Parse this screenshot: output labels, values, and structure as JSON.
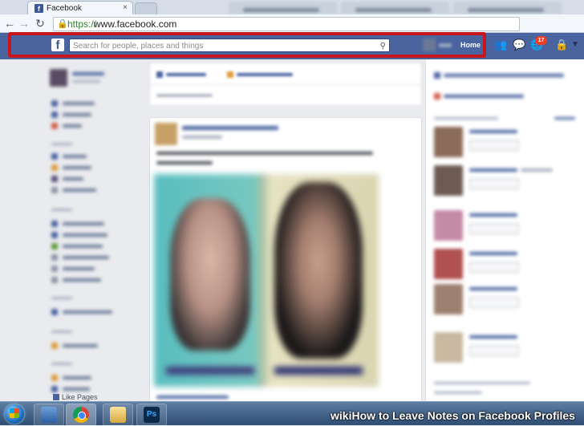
{
  "browser": {
    "tab_title": "Facebook",
    "tab_close": "×",
    "back_glyph": "←",
    "forward_glyph": "→",
    "reload_glyph": "↻",
    "url_scheme": "https://",
    "url_host": "www.facebook.com"
  },
  "facebook_bar": {
    "logo_letter": "f",
    "search_placeholder": "Search for people, places and things",
    "home_label": "Home",
    "notification_count": "17",
    "highlight_color": "#c8161d",
    "bar_color": "#4a64a0"
  },
  "left_sidebar": {
    "footer_label": "Like Pages"
  },
  "watermark": {
    "brand": "wiki",
    "text": "How to Leave Notes on Facebook Profiles"
  },
  "taskbar": {
    "apps": [
      "start-icon",
      "explorer-icon",
      "chrome-icon",
      "files-icon",
      "photoshop-icon"
    ],
    "photoshop_label": "Ps"
  }
}
